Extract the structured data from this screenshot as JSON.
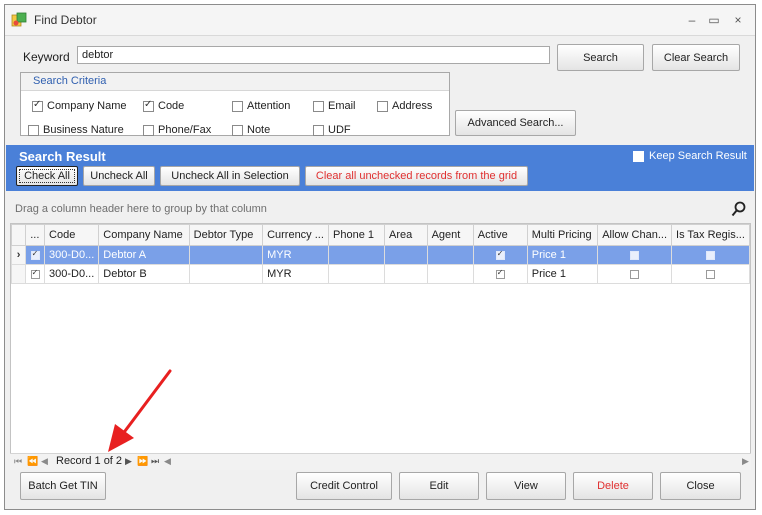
{
  "window": {
    "title": "Find Debtor",
    "minimize": "–",
    "maximize": "▭",
    "close": "×"
  },
  "search": {
    "keyword_label": "Keyword",
    "keyword_value": "debtor",
    "search_button": "Search",
    "clear_button": "Clear Search",
    "advanced_button": "Advanced Search..."
  },
  "criteria": {
    "title": "Search Criteria",
    "options": [
      {
        "label": "Company Name",
        "checked": true
      },
      {
        "label": "Code",
        "checked": true
      },
      {
        "label": "Attention",
        "checked": false
      },
      {
        "label": "Email",
        "checked": false
      },
      {
        "label": "Address",
        "checked": false
      },
      {
        "label": "Business Nature",
        "checked": false
      },
      {
        "label": "Phone/Fax",
        "checked": false
      },
      {
        "label": "Note",
        "checked": false
      },
      {
        "label": "UDF",
        "checked": false
      }
    ]
  },
  "result": {
    "title": "Search Result",
    "keep_label": "Keep Search Result",
    "check_all": "Check All",
    "uncheck_all": "Uncheck All",
    "uncheck_selection": "Uncheck All in Selection",
    "clear_unchecked": "Clear all unchecked records from the grid",
    "group_hint": "Drag a column header here to group by that column"
  },
  "grid": {
    "columns": [
      "...",
      "Code",
      "Company Name",
      "Debtor Type",
      "Currency ...",
      "Phone 1",
      "Area",
      "Agent",
      "Active",
      "Multi Pricing",
      "Allow Chan...",
      "Is Tax Regis..."
    ],
    "rows": [
      {
        "code": "300-D0...",
        "company": "Debtor A",
        "debtor_type": "",
        "currency": "MYR",
        "phone": "",
        "area": "",
        "agent": "",
        "active": true,
        "pricing": "Price 1",
        "allow_change": false,
        "tax_reg": false
      },
      {
        "code": "300-D0...",
        "company": "Debtor B",
        "debtor_type": "",
        "currency": "MYR",
        "phone": "",
        "area": "",
        "agent": "",
        "active": true,
        "pricing": "Price 1",
        "allow_change": false,
        "tax_reg": false
      }
    ]
  },
  "navigator": {
    "record_text": "Record 1 of 2"
  },
  "footer": {
    "batch_tin": "Batch Get TIN",
    "credit_control": "Credit Control",
    "edit": "Edit",
    "view": "View",
    "delete": "Delete",
    "close": "Close"
  },
  "colors": {
    "accent": "#4a80d8",
    "selection": "#7aa0e8",
    "danger": "#e03030"
  }
}
